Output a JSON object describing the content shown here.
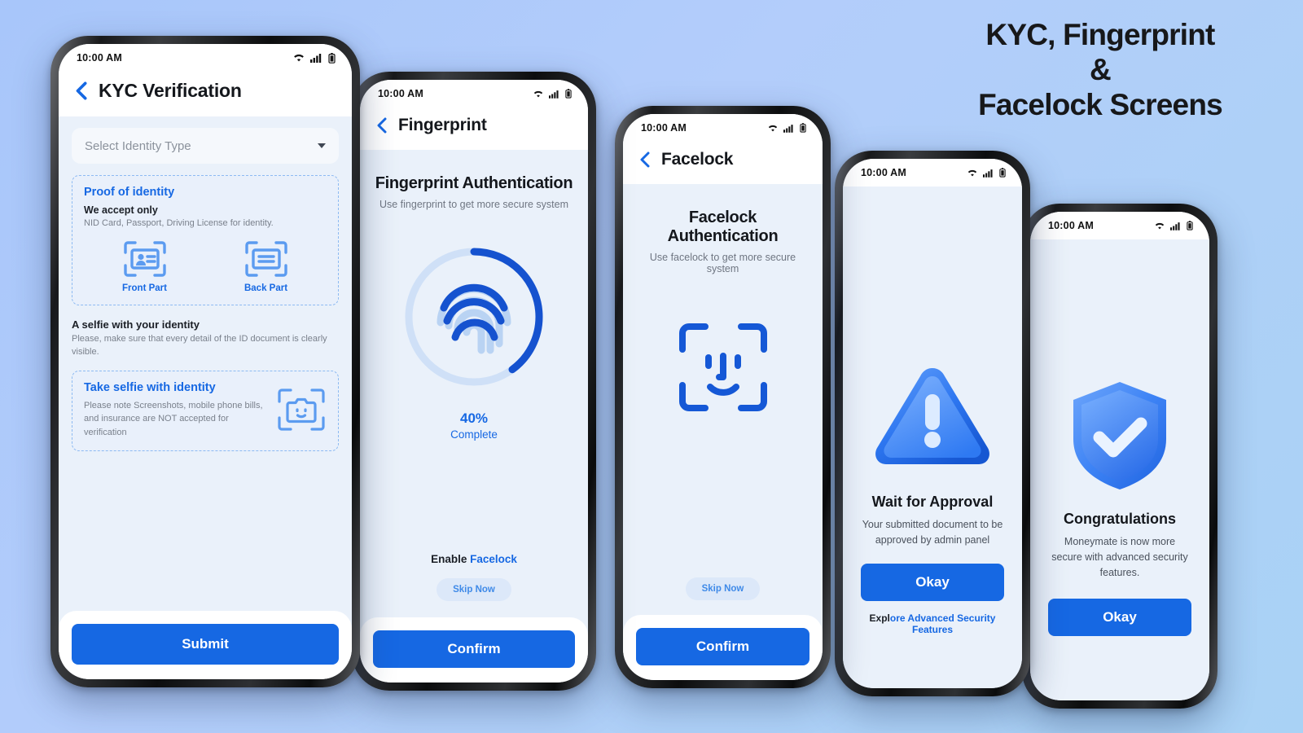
{
  "heading": {
    "line1": "KYC, Fingerprint",
    "line2": "&",
    "line3": "Facelock Screens"
  },
  "colors": {
    "accent": "#1668e3",
    "screen_bg": "#eaf1fa",
    "panel_bg": "#e9f0fb",
    "dash_border": "#8dbaf2",
    "muted_text": "#7a818c"
  },
  "status_bar": {
    "time": "10:00 AM",
    "wifi": "wifi-icon",
    "signal": "signal-icon",
    "battery": "battery-icon"
  },
  "phones": [
    {
      "id": "kyc",
      "appbar_title": "KYC Verification",
      "back": "back-chevron-icon",
      "select": {
        "placeholder": "Select Identity Type",
        "value": "",
        "caret": "chevron-down-icon"
      },
      "proof": {
        "title": "Proof of identity",
        "accept_title": "We accept only",
        "accept_sub": "NID Card, Passport, Driving License for identity.",
        "docs": [
          {
            "label": "Front Part",
            "icon": "id-card-front-icon"
          },
          {
            "label": "Back Part",
            "icon": "id-card-back-icon"
          }
        ]
      },
      "selfie_section": {
        "title": "A selfie with your identity",
        "sub": "Please, make sure that every detail of the ID document is clearly visible.",
        "card_title": "Take selfie with identity",
        "card_body": "Please note Screenshots, mobile phone bills, and insurance are NOT accepted for verification",
        "icon": "face-scan-camera-icon"
      },
      "footer_button": "Submit"
    },
    {
      "id": "fingerprint",
      "appbar_title": "Fingerprint",
      "title": "Fingerprint Authentication",
      "sub": "Use fingerprint to get more secure system",
      "progress": {
        "percent": 40,
        "percent_label": "40%",
        "status": "Complete",
        "icon": "fingerprint-icon"
      },
      "enable_prefix": "Enable ",
      "enable_link": "Facelock",
      "skip": "Skip Now",
      "footer_button": "Confirm"
    },
    {
      "id": "facelock",
      "appbar_title": "Facelock",
      "title": "Facelock Authentication",
      "sub": "Use facelock to get more secure system",
      "icon": "face-id-icon",
      "skip": "Skip Now",
      "footer_button": "Confirm"
    },
    {
      "id": "wait-approval",
      "icon": "warning-triangle-icon",
      "title": "Wait for Approval",
      "sub": "Your submitted document to be approved by admin panel",
      "button": "Okay",
      "link_prefix": "Expl",
      "link": "ore Advanced Security Features"
    },
    {
      "id": "congratulations",
      "icon": "shield-check-icon",
      "title": "Congratulations",
      "sub": "Moneymate is now more secure with advanced security features.",
      "button": "Okay"
    }
  ]
}
